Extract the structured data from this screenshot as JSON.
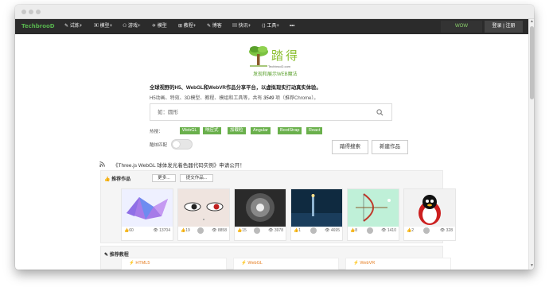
{
  "nav": {
    "brand": "TechbrooD",
    "items": [
      "✎ 试炼+",
      "▣ 模型+",
      "⚇ 游戏+",
      "✈ 模型",
      "⊞ 教程+",
      "✎ 博客",
      "▤ 快讯+",
      "⟨⟩ 工具+",
      "•••"
    ],
    "wow": "WOW",
    "login": "登录 | 注册"
  },
  "logo": {
    "chinese": "踏得",
    "site": "TechbrooD.com",
    "slogan": "发现和展示WEB魔法"
  },
  "intro": {
    "line1": "全球视野的H5、WebGL和WebVR作品分享平台，以虚拟现实打动真实体验。",
    "line2_prefix": "H5动画、特效、3D模型、教程、模组和工具等，共有",
    "count": "3549",
    "line2_suffix": "项（推荐Chrome）。"
  },
  "search": {
    "placeholder": "如：圆形"
  },
  "hot": {
    "label": "热搜：",
    "tags": [
      "WebGL",
      "响应式",
      "加载粒",
      "Angular",
      "BootStrap",
      "React"
    ]
  },
  "mode": {
    "label": "酷炫匹配"
  },
  "buttons": {
    "search": "踏得搜索",
    "create": "新建作品"
  },
  "notice": "《Three.js WebGL 球体发光着色器代码实例》申请公开！",
  "recommend": {
    "title": "推荐作品",
    "more": "更多...",
    "submit": "提交作品...",
    "cards": [
      {
        "likes": "60",
        "views": "13704"
      },
      {
        "likes": "19",
        "views": "8858"
      },
      {
        "likes": "15",
        "views": "3978"
      },
      {
        "likes": "1",
        "views": "4695"
      },
      {
        "likes": "8",
        "views": "1410"
      },
      {
        "likes": "2",
        "views": "328"
      }
    ]
  },
  "tutorials": {
    "title": "推荐教程",
    "items": [
      "HTML5",
      "WebGL",
      "WebVR"
    ]
  },
  "colors": {
    "navbar": "#2b2b2b",
    "brand_green": "#57b34e",
    "tag_green": "#6ab04c",
    "tutorial_orange": "#e67e22"
  }
}
